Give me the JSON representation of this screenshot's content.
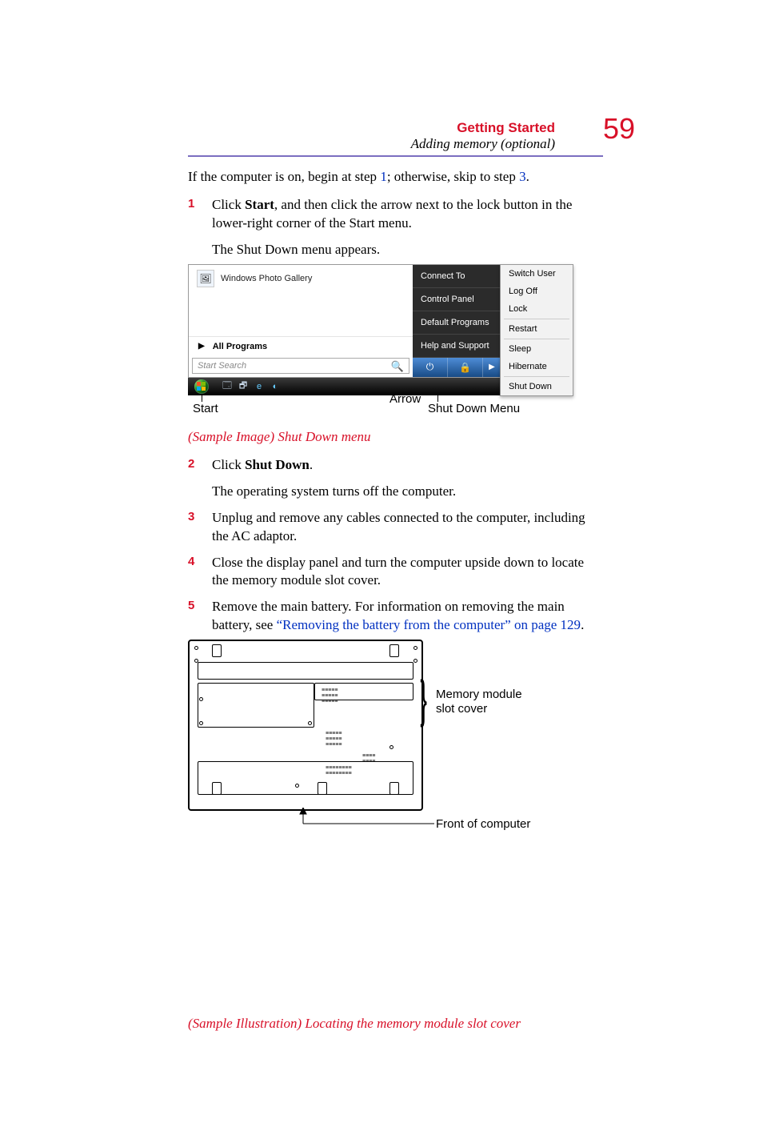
{
  "header": {
    "chapter": "Getting Started",
    "section": "Adding memory (optional)",
    "page_number": "59"
  },
  "intro": {
    "pre": "If the computer is on, begin at step ",
    "step_a": "1",
    "mid": "; otherwise, skip to step ",
    "step_b": "3",
    "post": "."
  },
  "steps": {
    "s1": {
      "num": "1",
      "text_pre": "Click ",
      "text_bold": "Start",
      "text_post": ", and then click the arrow next to the lock button in the lower-right corner of the Start menu.",
      "after": "The Shut Down menu appears."
    },
    "s2": {
      "num": "2",
      "text_pre": "Click ",
      "text_bold": "Shut Down",
      "text_post": ".",
      "after": "The operating system turns off the computer."
    },
    "s3": {
      "num": "3",
      "text": "Unplug and remove any cables connected to the computer, including the AC adaptor."
    },
    "s4": {
      "num": "4",
      "text": "Close the display panel and turn the computer upside down to locate the memory module slot cover."
    },
    "s5": {
      "num": "5",
      "text_pre": "Remove the main battery. For information on removing the main battery, see ",
      "link": "“Removing the battery from the computer” on page 129",
      "text_post": "."
    }
  },
  "fig1": {
    "caption": "(Sample Image) Shut Down menu",
    "left": {
      "gallery": "Windows Photo Gallery",
      "all_programs": "All Programs",
      "search_placeholder": "Start Search"
    },
    "right": {
      "connect_to": "Connect To",
      "control_panel": "Control Panel",
      "default_programs": "Default Programs",
      "help": "Help and Support"
    },
    "popout": {
      "switch_user": "Switch User",
      "log_off": "Log Off",
      "lock": "Lock",
      "restart": "Restart",
      "sleep": "Sleep",
      "hibernate": "Hibernate",
      "shut_down": "Shut Down"
    },
    "labels": {
      "start": "Start",
      "arrow": "Arrow",
      "menu": "Shut Down Menu"
    }
  },
  "fig2": {
    "caption": "(Sample Illustration) Locating the memory module slot cover",
    "label_slot": "Memory module slot cover",
    "label_front": "Front of computer"
  }
}
